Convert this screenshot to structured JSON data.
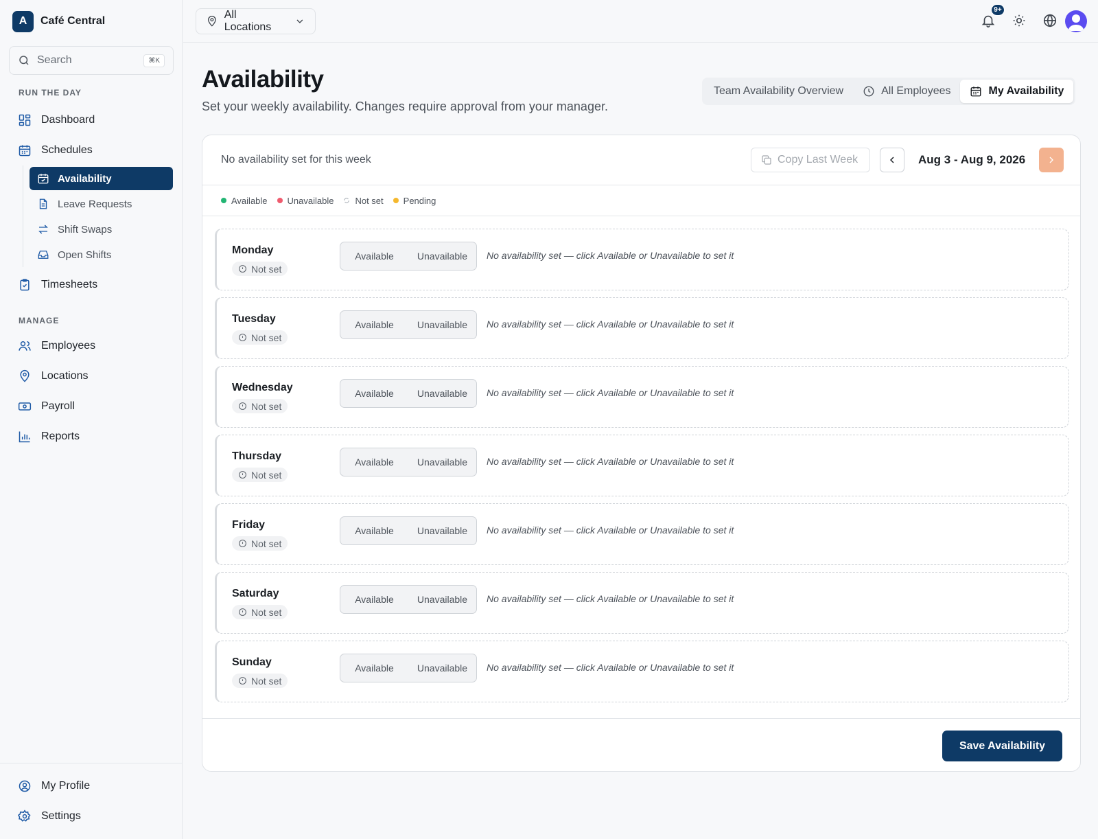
{
  "brand": {
    "logo_letter": "A",
    "name": "Café Central"
  },
  "search": {
    "placeholder": "Search",
    "shortcut": "⌘K"
  },
  "sidebar": {
    "section_run": "RUN THE DAY",
    "section_manage": "MANAGE",
    "dashboard": "Dashboard",
    "schedules": "Schedules",
    "sub_items": [
      {
        "label": "Availability",
        "icon": "calendar-check-icon",
        "active": true
      },
      {
        "label": "Leave Requests",
        "icon": "document-icon"
      },
      {
        "label": "Shift Swaps",
        "icon": "swap-arrows-icon"
      },
      {
        "label": "Open Shifts",
        "icon": "inbox-icon"
      }
    ],
    "timesheets": "Timesheets",
    "employees": "Employees",
    "locations": "Locations",
    "payroll": "Payroll",
    "reports": "Reports",
    "my_profile": "My Profile",
    "settings": "Settings"
  },
  "topbar": {
    "location_selector": "All Locations",
    "notification_badge": "9+"
  },
  "page": {
    "title": "Availability",
    "subtitle": "Set your weekly availability. Changes require approval from your manager."
  },
  "view_tabs": {
    "team_overview": "Team Availability Overview",
    "all_employees": "All Employees",
    "my_availability": "My Availability"
  },
  "card": {
    "status": "No availability set for this week",
    "copy_last_week": "Copy Last Week",
    "week_range": "Aug 3 - Aug 9, 2026",
    "save": "Save Availability"
  },
  "legend": {
    "available": "Available",
    "unavailable": "Unavailable",
    "not_set": "Not set",
    "pending": "Pending"
  },
  "days": [
    {
      "name": "Monday",
      "status": "Not set",
      "available": "Available",
      "unavailable": "Unavailable",
      "hint": "No availability set — click Available or Unavailable to set it"
    },
    {
      "name": "Tuesday",
      "status": "Not set",
      "available": "Available",
      "unavailable": "Unavailable",
      "hint": "No availability set — click Available or Unavailable to set it"
    },
    {
      "name": "Wednesday",
      "status": "Not set",
      "available": "Available",
      "unavailable": "Unavailable",
      "hint": "No availability set — click Available or Unavailable to set it"
    },
    {
      "name": "Thursday",
      "status": "Not set",
      "available": "Available",
      "unavailable": "Unavailable",
      "hint": "No availability set — click Available or Unavailable to set it"
    },
    {
      "name": "Friday",
      "status": "Not set",
      "available": "Available",
      "unavailable": "Unavailable",
      "hint": "No availability set — click Available or Unavailable to set it"
    },
    {
      "name": "Saturday",
      "status": "Not set",
      "available": "Available",
      "unavailable": "Unavailable",
      "hint": "No availability set — click Available or Unavailable to set it"
    },
    {
      "name": "Sunday",
      "status": "Not set",
      "available": "Available",
      "unavailable": "Unavailable",
      "hint": "No availability set — click Available or Unavailable to set it"
    }
  ],
  "colors": {
    "brand": "#0e3a66",
    "available": "#22b573",
    "unavailable": "#ef5b6e",
    "not_set": "#b8bdc3",
    "pending": "#f5b82e",
    "next_button": "#f3b28f"
  }
}
